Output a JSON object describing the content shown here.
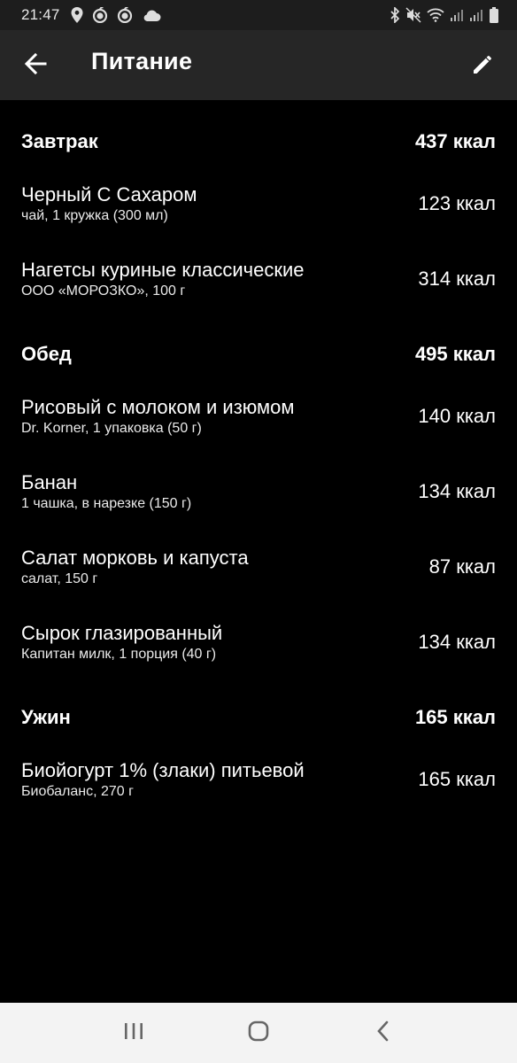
{
  "status_bar": {
    "time": "21:47",
    "left_icons": [
      "location-pin-icon",
      "apple-logo-icon",
      "apple-logo-icon",
      "cloud-icon"
    ],
    "right_icons": [
      "bluetooth-icon",
      "mute-icon",
      "wifi-icon",
      "signal-icon",
      "signal-icon",
      "battery-icon"
    ]
  },
  "app_bar": {
    "title": "Питание",
    "back_icon": "arrow-back-icon",
    "edit_icon": "pencil-icon"
  },
  "sections": [
    {
      "title": "Завтрак",
      "total": "437 ккал",
      "items": [
        {
          "name": "Черный С Сахаром",
          "detail": "чай, 1 кружка (300 мл)",
          "kcal": "123 ккал"
        },
        {
          "name": "Нагетсы куриные классические",
          "detail": "ООО  «МОРОЗКО», 100 г",
          "kcal": "314 ккал"
        }
      ]
    },
    {
      "title": "Обед",
      "total": "495 ккал",
      "items": [
        {
          "name": "Рисовый с молоком и изюмом",
          "detail": "Dr. Korner, 1 упаковка (50 г)",
          "kcal": "140 ккал"
        },
        {
          "name": "Банан",
          "detail": "1 чашка, в нарезке (150 г)",
          "kcal": "134 ккал"
        },
        {
          "name": "Салат  морковь и капуста",
          "detail": "салат, 150 г",
          "kcal": "87 ккал"
        },
        {
          "name": "Сырок глазированный",
          "detail": "Капитан милк, 1 порция (40 г)",
          "kcal": "134 ккал"
        }
      ]
    },
    {
      "title": "Ужин",
      "total": "165 ккал",
      "items": [
        {
          "name": "Биойогурт 1% (злаки) питьевой",
          "detail": "Биобаланс, 270 г",
          "kcal": "165 ккал"
        }
      ]
    }
  ],
  "nav_bar": {
    "buttons": [
      "recent-apps-icon",
      "home-icon",
      "back-icon"
    ]
  },
  "colors": {
    "background": "#000000",
    "app_bar": "#262626",
    "status_bar": "#1d1d1d",
    "nav_bar": "#f3f3f3",
    "text": "#ffffff"
  }
}
